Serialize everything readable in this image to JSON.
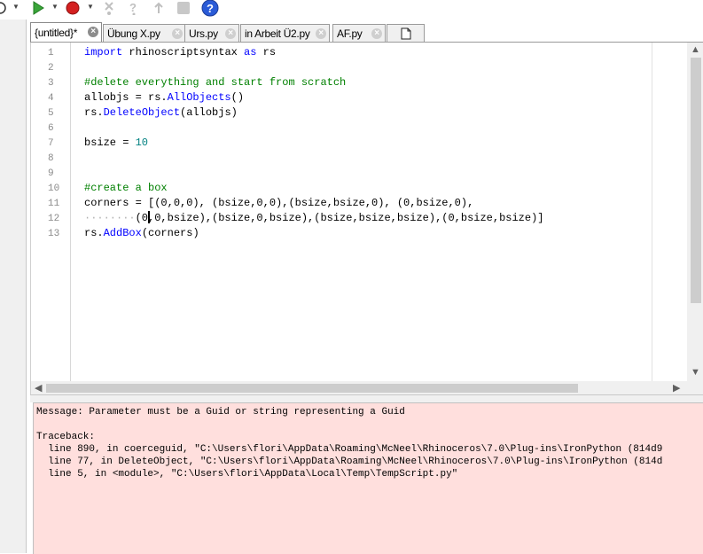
{
  "toolbar": {
    "buttons": [
      "run-icon",
      "stop-icon",
      "step-over-icon",
      "step-into-icon",
      "step-out-icon",
      "stop-square-icon",
      "help-icon"
    ]
  },
  "tabs": [
    {
      "label": "{untitled}*",
      "active": true
    },
    {
      "label": "Übung X.py",
      "active": false
    },
    {
      "label": "Urs.py",
      "active": false
    },
    {
      "label": "in Arbeit Ü2.py",
      "active": false
    },
    {
      "label": "AF.py",
      "active": false
    }
  ],
  "editor": {
    "line_numbers": [
      "1",
      "2",
      "3",
      "4",
      "5",
      "6",
      "7",
      "8",
      "9",
      "10",
      "11",
      "12",
      "13"
    ],
    "lines": {
      "l1": {
        "kw": "import",
        "rest": " rhinoscriptsyntax ",
        "kw2": "as",
        "rest2": " rs"
      },
      "l3": "#delete everything and start from scratch",
      "l4": {
        "a": "allobjs = rs.",
        "b": "AllObjects",
        "c": "()"
      },
      "l5": {
        "a": "rs.",
        "b": "DeleteObject",
        "c": "(allobjs)"
      },
      "l7": {
        "a": "bsize = ",
        "b": "10"
      },
      "l10": "#create a box",
      "l11": "corners = [(0,0,0), (bsize,0,0),(bsize,bsize,0), (0,bsize,0),",
      "l12": {
        "dots": "········",
        "rest": "(0,0,bsize),(bsize,0,bsize),(bsize,bsize,bsize),(0,bsize,bsize)]"
      },
      "l13": {
        "a": "rs.",
        "b": "AddBox",
        "c": "(corners)"
      }
    }
  },
  "output": {
    "message": "Message: Parameter must be a Guid or string representing a Guid",
    "traceback_label": "Traceback:",
    "trace1": "  line 890, in coerceguid, \"C:\\Users\\flori\\AppData\\Roaming\\McNeel\\Rhinoceros\\7.0\\Plug-ins\\IronPython (814d9",
    "trace2": "  line 77, in DeleteObject, \"C:\\Users\\flori\\AppData\\Roaming\\McNeel\\Rhinoceros\\7.0\\Plug-ins\\IronPython (814d",
    "trace3": "  line 5, in <module>, \"C:\\Users\\flori\\AppData\\Local\\Temp\\TempScript.py\""
  },
  "colors": {
    "keyword": "#0000ff",
    "comment": "#008000",
    "number": "#008080",
    "error_bg": "#ffdfdd"
  }
}
